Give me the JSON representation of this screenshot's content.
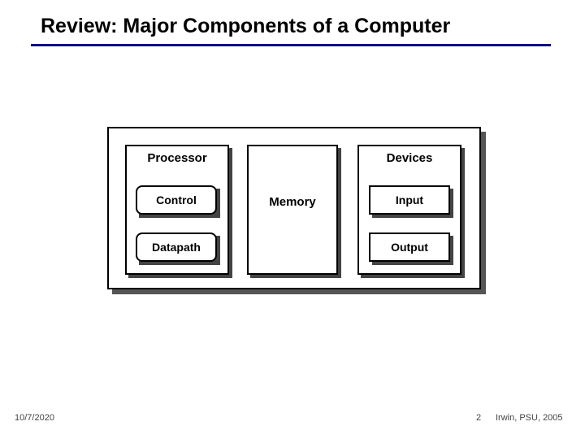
{
  "title": "Review:  Major Components of a Computer",
  "processor": {
    "header": "Processor",
    "control": "Control",
    "datapath": "Datapath"
  },
  "memory": {
    "label": "Memory"
  },
  "devices": {
    "header": "Devices",
    "input": "Input",
    "output": "Output"
  },
  "footer": {
    "date": "10/7/2020",
    "page": "2",
    "credit": "Irwin, PSU, 2005"
  }
}
